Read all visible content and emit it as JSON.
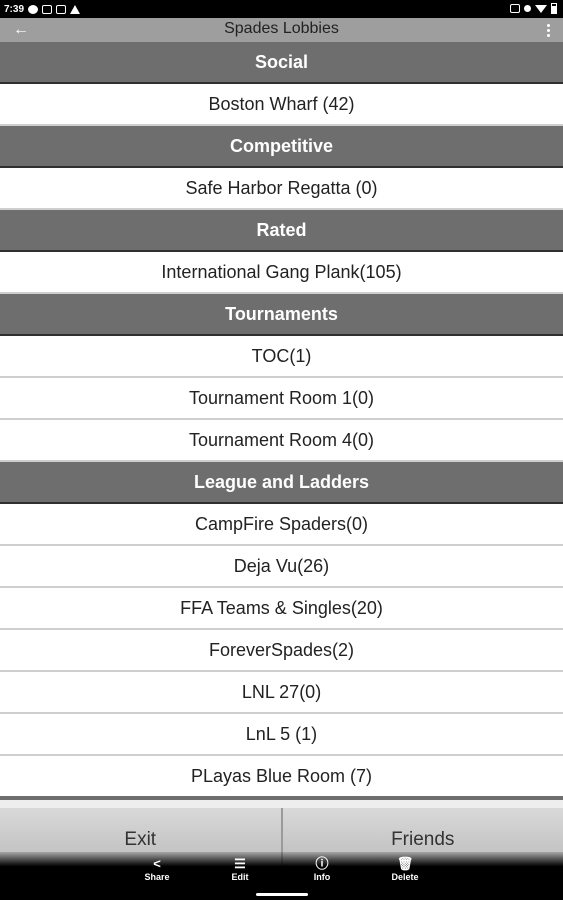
{
  "status_bar": {
    "time": "7:39"
  },
  "app_bar": {
    "title": "Spades Lobbies",
    "back_icon": "arrow-left-icon",
    "menu_icon": "overflow-menu-icon"
  },
  "sections": [
    {
      "header": "Social",
      "rooms": [
        "Boston Wharf (42)"
      ]
    },
    {
      "header": "Competitive",
      "rooms": [
        "Safe Harbor Regatta (0)"
      ]
    },
    {
      "header": "Rated",
      "rooms": [
        "International Gang Plank(105)"
      ]
    },
    {
      "header": "Tournaments",
      "rooms": [
        "TOC(1)",
        "Tournament Room 1(0)",
        "Tournament Room 4(0)"
      ]
    },
    {
      "header": "League and Ladders",
      "rooms": [
        "CampFire Spaders(0)",
        "Deja Vu(26)",
        "FFA Teams & Singles(20)",
        "ForeverSpades(2)",
        "LNL 27(0)",
        "LnL 5 (1)",
        "PLayas Blue Room (7)"
      ]
    }
  ],
  "buttons": {
    "exit": "Exit",
    "friends": "Friends"
  },
  "share_bar": {
    "share": "Share",
    "edit": "Edit",
    "info": "Info",
    "delete": "Delete"
  },
  "colors": {
    "header_bg": "#6d6e6d",
    "app_bar_bg": "#9e9e9e",
    "row_bg": "#ffffff"
  }
}
